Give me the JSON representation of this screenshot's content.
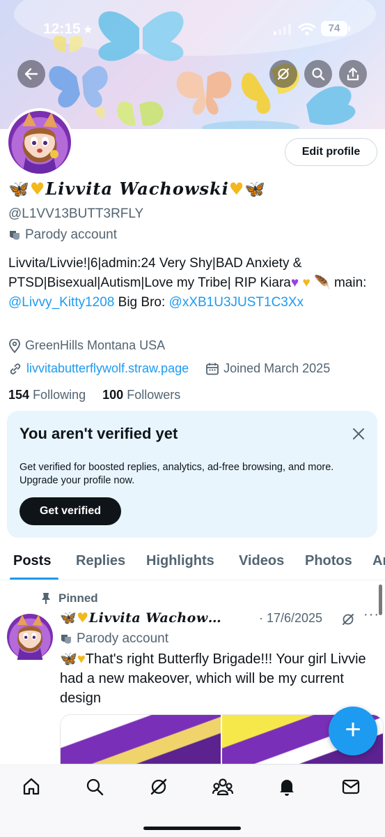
{
  "status_bar": {
    "time": "12:15",
    "star": "★",
    "battery": "74"
  },
  "profile": {
    "edit_label": "Edit profile",
    "display_name_text": "Livvita Wachowski",
    "handle": "@L1VV13BUTT3RFLY",
    "parody_label": "Parody account",
    "bio": {
      "line1": "Livvita/Livvie!|6|admin:24 Very Shy|BAD Anxiety & PTSD|Bisexual|Autism|Love my Tribe| RIP Kiara",
      "main_label": "main:",
      "main_link": "@Livvy_Kitty1208",
      "bro_label": "Big Bro:",
      "bro_link": "@xXB1U3JUST1C3Xx"
    },
    "location": "GreenHills Montana USA",
    "website": "livvitabutterflywolf.straw.page",
    "joined": "Joined March 2025",
    "following_count": "154",
    "following_label": "Following",
    "followers_count": "100",
    "followers_label": "Followers"
  },
  "verify_card": {
    "title": "You aren't verified yet",
    "body": "Get verified for boosted replies, analytics, ad-free browsing, and more. Upgrade your profile now.",
    "button": "Get verified"
  },
  "tabs": [
    "Posts",
    "Replies",
    "Highlights",
    "Videos",
    "Photos",
    "Articles"
  ],
  "tab_visible_last": "Ar",
  "post": {
    "pinned_label": "Pinned",
    "author_name": "Livvita Wachow…",
    "date": "· 17/6/2025",
    "more": "···",
    "parody_label": "Parody account",
    "text": "That's right Butterfly Brigade!!! Your girl Livvie had a new makeover, which will be my current design"
  },
  "fab_label": "+",
  "colors": {
    "accent": "#1d9bf0",
    "text": "#0f1419",
    "muted": "#536471",
    "verify_bg": "#e8f5fd"
  },
  "icons": [
    "back-icon",
    "grok-icon",
    "search-icon",
    "share-icon",
    "parody-mask-icon",
    "location-icon",
    "link-icon",
    "calendar-icon",
    "close-icon",
    "pin-icon",
    "home-icon",
    "explore-icon",
    "grok-nav-icon",
    "communities-icon",
    "notifications-icon",
    "messages-icon"
  ]
}
